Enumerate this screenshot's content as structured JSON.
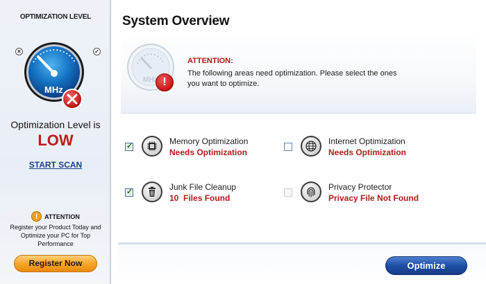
{
  "sidebar": {
    "title": "OPTIMIZATION LEVEL",
    "gauge_label": "MHz",
    "level_label": "Optimization Level is",
    "level_value": "LOW",
    "start_scan": "START SCAN",
    "attention_label": "ATTENTION",
    "attention_message": "Register your Product Today and Optimize your PC for Top Performance",
    "register_button": "Register Now"
  },
  "main": {
    "title": "System Overview",
    "attention": {
      "heading": "ATTENTION:",
      "message": "The following areas need optimization. Please select the ones you want to optimize.",
      "gauge_label": "MHz"
    },
    "items": [
      {
        "name": "Memory Optimization",
        "status": "Needs Optimization",
        "checked": true,
        "icon": "chip-icon"
      },
      {
        "name": "Internet Optimization",
        "status": "Needs Optimization",
        "checked": false,
        "icon": "globe-icon"
      },
      {
        "name": "Junk File Cleanup",
        "status": "10  Files Found",
        "checked": true,
        "icon": "trash-icon"
      },
      {
        "name": "Privacy Protector",
        "status": "Privacy File Not Found",
        "checked": false,
        "disabled": true,
        "icon": "fingerprint-icon"
      }
    ],
    "optimize_button": "Optimize"
  },
  "colors": {
    "status_red": "#b01c1c",
    "level_red": "#c11a1a",
    "accent_blue": "#1e4fa6",
    "register_orange": "#f7a628"
  }
}
